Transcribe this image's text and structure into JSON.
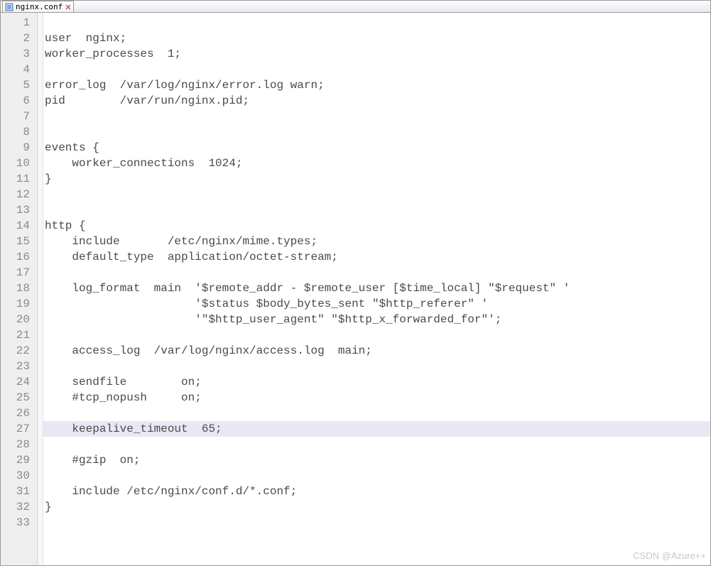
{
  "tab": {
    "filename": "nginx.conf",
    "file_icon": "file-icon",
    "close_icon": "close-icon"
  },
  "highlighted_line": 27,
  "lines": [
    "",
    "user  nginx;",
    "worker_processes  1;",
    "",
    "error_log  /var/log/nginx/error.log warn;",
    "pid        /var/run/nginx.pid;",
    "",
    "",
    "events {",
    "    worker_connections  1024;",
    "}",
    "",
    "",
    "http {",
    "    include       /etc/nginx/mime.types;",
    "    default_type  application/octet-stream;",
    "",
    "    log_format  main  '$remote_addr - $remote_user [$time_local] \"$request\" '",
    "                      '$status $body_bytes_sent \"$http_referer\" '",
    "                      '\"$http_user_agent\" \"$http_x_forwarded_for\"';",
    "",
    "    access_log  /var/log/nginx/access.log  main;",
    "",
    "    sendfile        on;",
    "    #tcp_nopush     on;",
    "",
    "    keepalive_timeout  65;",
    "",
    "    #gzip  on;",
    "",
    "    include /etc/nginx/conf.d/*.conf;",
    "}",
    ""
  ],
  "watermark": "CSDN @Azure++"
}
